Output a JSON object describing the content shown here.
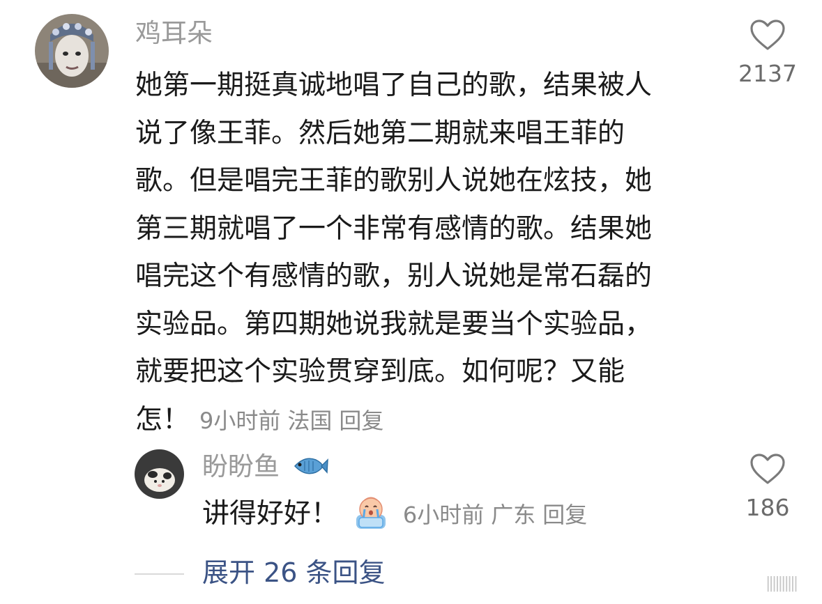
{
  "comment": {
    "username": "鸡耳朵",
    "lines": [
      "她第一期挺真诚地唱了自己的歌，结果被人",
      "说了像王菲。然后她第二期就来唱王菲的",
      "歌。但是唱完王菲的歌别人说她在炫技，她",
      "第三期就唱了一个非常有感情的歌。结果她",
      "唱完这个有感情的歌，别人说她是常石磊的",
      "实验品。第四期她说我就是要当个实验品，",
      "就要把这个实验贯穿到底。如何呢？又能",
      "怎！"
    ],
    "time": "9小时前",
    "location": "法国",
    "reply_label": "回复",
    "likes": "2137"
  },
  "reply": {
    "username": "盼盼鱼",
    "badge_icon": "fish-icon",
    "text": "讲得好好！",
    "sticker_icon": "crying-face-sticker",
    "time": "6小时前",
    "location": "广东",
    "reply_label": "回复",
    "likes": "186"
  },
  "expand_label": "展开 26 条回复",
  "watermark": "||||||||||",
  "colors": {
    "username": "#9a9a9a",
    "text": "#1a1a1a",
    "meta": "#8a8a8a",
    "link": "#3b5385",
    "like_count": "#6b6b6b"
  }
}
